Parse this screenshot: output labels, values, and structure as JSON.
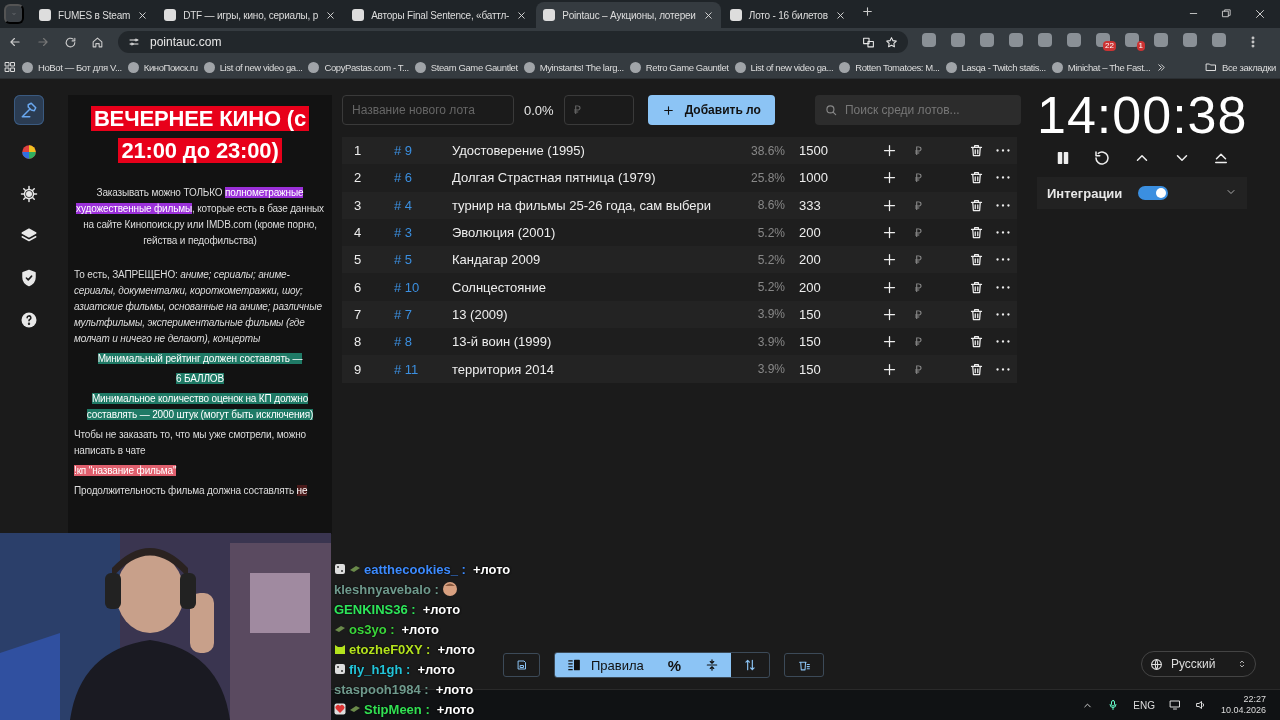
{
  "browser": {
    "tabs": [
      {
        "title": "FUMES в Steam",
        "selected": false
      },
      {
        "title": "DTF — игры, кино, сериалы, р",
        "selected": false
      },
      {
        "title": "Авторы Final Sentence, «баттл-",
        "selected": false
      },
      {
        "title": "Pointauc – Аукционы, лотереи",
        "selected": true
      },
      {
        "title": "Лото - 16 билетов",
        "selected": false
      }
    ],
    "address": "pointauc.com",
    "extensions": [
      {
        "kind": "plain"
      },
      {
        "kind": "plain"
      },
      {
        "kind": "plain"
      },
      {
        "kind": "plain"
      },
      {
        "kind": "plain"
      },
      {
        "kind": "plain"
      },
      {
        "kind": "badged",
        "badge": "22"
      },
      {
        "kind": "badged",
        "badge": "1"
      },
      {
        "kind": "plain"
      },
      {
        "kind": "plain"
      },
      {
        "kind": "plain"
      }
    ],
    "bookmarks": [
      "НоBot — Бот для V...",
      "КиноПоиск.ru",
      "List of new video ga...",
      "CopyPastas.com - T...",
      "Steam Game Gauntlet",
      "Myinstants! The larg...",
      "Retro Game Gauntlet",
      "List of new video ga...",
      "Rotten Tomatoes: M...",
      "Lasqa - Twitch statis...",
      "Minichat – The Fast..."
    ],
    "all_bookmarks": "Все закладки"
  },
  "sidebar": {
    "items": [
      {
        "selected": true
      },
      {
        "selected": false
      },
      {
        "selected": false
      },
      {
        "selected": false
      },
      {
        "selected": false
      },
      {
        "selected": false
      }
    ]
  },
  "rules": {
    "title": "ВЕЧЕРНЕЕ КИНО (с 21:00 до 23:00)",
    "paragraphs": [
      {
        "kind": "centered",
        "parts": [
          {
            "text": "Заказывать можно ТОЛЬКО "
          },
          {
            "text": "полнометражные художественные фильмы",
            "color": "#9b30d9"
          },
          {
            "text": ", которые есть в базе данных на сайте Кинопоиск.ру или IMDB.com (кроме порно, гейства и педофильства)"
          }
        ]
      },
      {
        "kind": "plain",
        "parts": [
          {
            "text": "То есть, ЗАПРЕЩЕНО: *аниме; сериалы; аниме-сериалы, документалки, короткометражки, шоу; азиатские фильмы, основанные на аниме; различные мультфильмы, экспериментальные фильмы (где молчат и ничего не делают), концерты*"
          }
        ]
      },
      {
        "kind": "centered",
        "parts": [
          {
            "text": "Минимальный рейтинг должен составлять —",
            "color": "#1f7a66"
          }
        ]
      },
      {
        "kind": "centered",
        "parts": [
          {
            "text": "6 БАЛЛОВ",
            "color": "#1f7a66"
          }
        ]
      },
      {
        "kind": "centered",
        "parts": [
          {
            "text": "Минимальное количество оценок на КП должно составлять — 2000 штук (могут быть исключения)",
            "color": "#1f7a66"
          }
        ]
      },
      {
        "kind": "plain",
        "parts": [
          {
            "text": "Чтобы не заказать то, что мы уже смотрели, можно написать в чате"
          }
        ]
      },
      {
        "kind": "plain",
        "parts": [
          {
            "text": "!кп \"название фильма\"",
            "color": "#e0606e"
          }
        ]
      },
      {
        "kind": "plain",
        "parts": [
          {
            "text": "Продолжительность фильма должна составлять "
          },
          {
            "text": "не",
            "color": "#4a1a1a"
          }
        ]
      }
    ]
  },
  "lots": {
    "name_placeholder": "Название нового лота",
    "percent": "0.0%",
    "amount_placeholder": "₽",
    "add_button": "Добавить ло",
    "search_placeholder": "Поиск среди лотов...",
    "rows": [
      {
        "index": "1",
        "id": "# 9",
        "name": "Удостоверение (1995)",
        "percent": "38.6%",
        "amount": "1500",
        "currency": "₽"
      },
      {
        "index": "2",
        "id": "# 6",
        "name": "Долгая Страстная пятница (1979)",
        "percent": "25.8%",
        "amount": "1000",
        "currency": "₽"
      },
      {
        "index": "3",
        "id": "# 4",
        "name": "турнир на фильмы 25-26 года, сам выбери",
        "percent": "8.6%",
        "amount": "333",
        "currency": "₽"
      },
      {
        "index": "4",
        "id": "# 3",
        "name": "Эволюция (2001)",
        "percent": "5.2%",
        "amount": "200",
        "currency": "₽"
      },
      {
        "index": "5",
        "id": "# 5",
        "name": "Кандагар 2009",
        "percent": "5.2%",
        "amount": "200",
        "currency": "₽"
      },
      {
        "index": "6",
        "id": "# 10",
        "name": "Солнцестояние",
        "percent": "5.2%",
        "amount": "200",
        "currency": "₽"
      },
      {
        "index": "7",
        "id": "# 7",
        "name": "13 (2009)",
        "percent": "3.9%",
        "amount": "150",
        "currency": "₽"
      },
      {
        "index": "8",
        "id": "# 8",
        "name": "13-й воин (1999)",
        "percent": "3.9%",
        "amount": "150",
        "currency": "₽"
      },
      {
        "index": "9",
        "id": "# 11",
        "name": "территория 2014",
        "percent": "3.9%",
        "amount": "150",
        "currency": "₽"
      }
    ]
  },
  "timer": {
    "time": "14:00:38"
  },
  "integrations": {
    "label": "Интеграции",
    "on": true
  },
  "footer": {
    "toggles": [
      {
        "kind": "rules",
        "label": "Правила",
        "selected": true
      },
      {
        "kind": "percent",
        "label": "%",
        "selected": true
      },
      {
        "kind": "compress",
        "selected": true
      },
      {
        "kind": "sort",
        "selected": false
      }
    ],
    "language": "Русский"
  },
  "chat": {
    "messages": [
      {
        "user": "eatthecookies_ :",
        "color": "#3d8bff",
        "kind": "text",
        "text": "+лото",
        "badges": [
          {
            "kind": "dice"
          },
          {
            "kind": "money"
          }
        ]
      },
      {
        "user": "kleshnyavebalo :",
        "color": "#6f9a8d",
        "kind": "emote"
      },
      {
        "user": "GENKINS36 :",
        "color": "#2ee65a",
        "kind": "text",
        "text": "+лото"
      },
      {
        "user": "os3yo :",
        "color": "#3bd63b",
        "kind": "text",
        "text": "+лото",
        "badges": [
          {
            "kind": "money"
          }
        ]
      },
      {
        "user": "etozheF0XY :",
        "color": "#b4e31d",
        "kind": "text",
        "text": "+лото",
        "badges": [
          {
            "kind": "cat"
          }
        ]
      },
      {
        "user": "fly_h1gh :",
        "color": "#23c4d9",
        "kind": "text",
        "text": "+лото",
        "badges": [
          {
            "kind": "dice"
          }
        ]
      },
      {
        "user": "staspooh1984 :",
        "color": "#6f9a8d",
        "kind": "text",
        "text": "+лото"
      },
      {
        "user": "StipMeen :",
        "color": "#32e052",
        "kind": "text",
        "text": "+лото",
        "badges": [
          {
            "kind": "heart"
          },
          {
            "kind": "money"
          }
        ]
      }
    ]
  },
  "taskbar": {
    "language": "ENG",
    "time": "22:27",
    "date": "10.04.2026"
  }
}
